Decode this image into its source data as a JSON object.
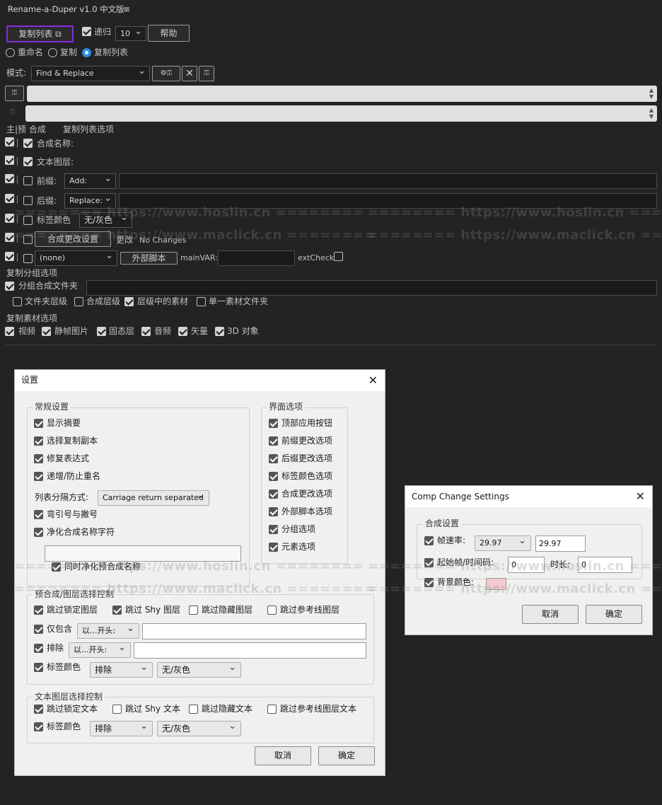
{
  "app": {
    "title": "Rename-a-Duper v1.0 中文版"
  },
  "top": {
    "copy_list_btn": "复制列表 ⧉",
    "recursive": "递归",
    "depth": "10",
    "help": "帮助",
    "modes": [
      "重命名",
      "复制",
      "复制列表"
    ],
    "mode_label": "模式:",
    "mode_value": "Find & Replace",
    "tool_btn1": "⚙⚿",
    "tool_btn3": "⚿",
    "left_btn": "⚿",
    "left_btn2": "⚿"
  },
  "list": {
    "header_main": "主|预 合成",
    "header_options": "复制列表选项",
    "comp_name": "合成名称:",
    "text_layer": "文本图层:",
    "prefix": "前缀:",
    "prefix_mode": "Add:",
    "suffix": "后缀:",
    "suffix_mode": "Replace:",
    "label_color": "标签颜色",
    "label_color_value": "无/灰色",
    "comp_change_btn": "合成更改设置",
    "change_label": "更改",
    "no_changes": "No Changes",
    "script_select": "(none)",
    "ext_script_btn": "外部脚本",
    "mainvar": "mainVAR:",
    "extcheck": "extCheck"
  },
  "group": {
    "title": "复制分组选项",
    "group_folder": "分组合成文件夹",
    "options": [
      "文件夹层级",
      "合成层级",
      "层级中的素材",
      "单一素材文件夹"
    ]
  },
  "footage": {
    "title": "复制素材选项",
    "options": [
      "视频",
      "静帧图片",
      "固态层",
      "音频",
      "矢量",
      "3D 对象"
    ]
  },
  "watermarks": {
    "a": "======== https://www.hoslin.cn ========",
    "b": "======== https://www.maclick.cn ========"
  },
  "settings": {
    "title": "设置",
    "general_title": "常规设置",
    "general": [
      "显示摘要",
      "选择复制副本",
      "修复表达式",
      "递增/防止重名"
    ],
    "separator_label": "列表分隔方式:",
    "separator_value": "Carriage return separated",
    "quotes": "弯引号与撇号",
    "sanitize": "净化合成名称字符",
    "sanitize_pre": "同时净化预合成名称",
    "ui_title": "界面选项",
    "ui": [
      "顶部应用按钮",
      "前缀更改选项",
      "后缀更改选项",
      "标签颜色选项",
      "合成更改选项",
      "外部脚本选项",
      "分组选项",
      "元素选项"
    ],
    "layer_title": "预合成/图层选择控制",
    "skip_locked": "跳过锁定图层",
    "skip_shy": "跳过 Shy 图层",
    "skip_hidden": "跳过隐藏图层",
    "skip_guide": "跳过参考线图层",
    "only_contain": "仅包含",
    "starts_with": "以...开头:",
    "exclude": "排除",
    "label_color": "标签颜色",
    "exclude_value": "排除",
    "color_value": "无/灰色",
    "text_title": "文本图层选择控制",
    "skip_locked_text": "跳过锁定文本",
    "skip_shy_text": "跳过 Shy 文本",
    "skip_hidden_text": "跳过隐藏文本",
    "skip_guide_text": "跳过参考线图层文本",
    "cancel": "取消",
    "ok": "确定"
  },
  "comp_change": {
    "title": "Comp Change Settings",
    "group": "合成设置",
    "fps_label": "帧速率:",
    "fps_select": "29.97",
    "fps_input": "29.97",
    "start_label": "起始帧/时间码:",
    "start_value": "0",
    "duration_label": "时长:",
    "duration_value": "0",
    "bg_label": "背景颜色:",
    "bg_color": "#f2c9cf",
    "cancel": "取消",
    "ok": "确定"
  }
}
